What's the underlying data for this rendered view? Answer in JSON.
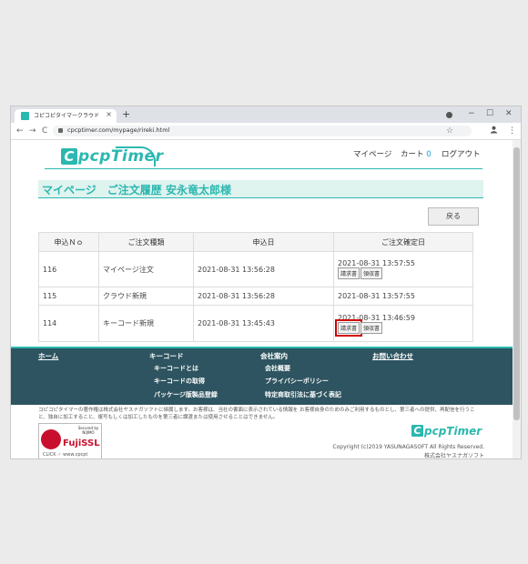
{
  "browser": {
    "tab_title": "コピコピタイマークラウド",
    "tab_close": "×",
    "new_tab": "+",
    "minimize": "−",
    "maximize": "☐",
    "close": "✕",
    "back": "←",
    "forward": "→",
    "reload": "C",
    "url": "cpcptimer.com/mypage/rireki.html",
    "star": "☆",
    "menu": "⋮"
  },
  "header": {
    "logo_text": "pcpTimer",
    "logo_letter": "C",
    "nav": {
      "mypage": "マイページ",
      "cart": "カート",
      "cart_count": "0",
      "logout": "ログアウト"
    }
  },
  "main": {
    "title": "マイページ　ご注文履歴 安永竜太郎様",
    "back_button": "戻る",
    "table": {
      "headers": [
        "申込Ｎｏ",
        "ご注文種類",
        "申込日",
        "ご注文確定日"
      ],
      "rows": [
        {
          "no": "116",
          "type": "マイページ注文",
          "date": "2021-08-31 13:56:28",
          "confirmed": "2021-08-31 13:57:55",
          "btn1": "請求書",
          "btn2": "領収書"
        },
        {
          "no": "115",
          "type": "クラウド新規",
          "date": "2021-08-31 13:56:28",
          "confirmed": "2021-08-31 13:57:55"
        },
        {
          "no": "114",
          "type": "キーコード新規",
          "date": "2021-08-31 13:45:43",
          "confirmed": "2021-08-31 13:46:59",
          "btn1": "請求書",
          "btn2": "領収書"
        }
      ]
    }
  },
  "footer": {
    "home": "ホーム",
    "keycode": {
      "title": "キーコード",
      "items": [
        "キーコードとは",
        "キーコードの取得",
        "パッケージ版製品登録"
      ]
    },
    "company": {
      "title": "会社案内",
      "items": [
        "会社概要",
        "プライバシーポリシー",
        "特定商取引法に基づく表記"
      ]
    },
    "contact": "お問い合わせ",
    "note": "コピコピタイマーの著作権は株式会社ヤスナガソフトに帰属します。お客様は、当社の書面に表示されている情報を お客様自身のためのみご利用するものとし、第三者への提供、再配信を行うこと、独自に加工すること、複写もしくは加工したものを第三者に譲渡または使用させることはできません。",
    "ssl": {
      "secured": "Secured by NIJIMO",
      "brand": "FujiSSL",
      "click": "CLICK ☞ www.cpcpt"
    },
    "copyright": "Copyright (c)2019 YASUNAGASOFT All Rights Reserved.",
    "company_name": "株式会社ヤスナガソフト"
  }
}
